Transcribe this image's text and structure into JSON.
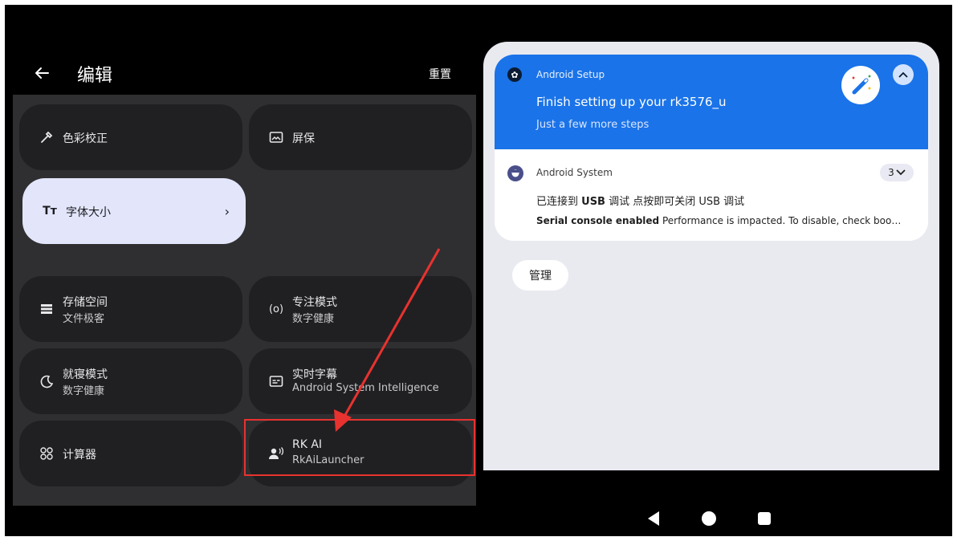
{
  "header": {
    "title": "编辑",
    "reset_label": "重置"
  },
  "tiles": [
    {
      "id": "color-correction",
      "icon": "dropper-icon",
      "label": "色彩校正",
      "sublabel": ""
    },
    {
      "id": "screensaver",
      "icon": "screensaver-icon",
      "label": "屏保",
      "sublabel": ""
    },
    {
      "id": "font-size",
      "icon": "font-size-icon",
      "label": "字体大小",
      "sublabel": "",
      "active": true
    },
    {
      "id": "storage",
      "icon": "storage-icon",
      "label": "存储空间",
      "sublabel": "文件极客"
    },
    {
      "id": "focus-mode",
      "icon": "focus-icon",
      "label": "专注模式",
      "sublabel": "数字健康"
    },
    {
      "id": "bedtime-mode",
      "icon": "bedtime-icon",
      "label": "就寝模式",
      "sublabel": "数字健康"
    },
    {
      "id": "live-caption",
      "icon": "caption-icon",
      "label": "实时字幕",
      "sublabel": "Android System Intelligence"
    },
    {
      "id": "calculator",
      "icon": "calculator-icon",
      "label": "计算器",
      "sublabel": ""
    },
    {
      "id": "rk-ai",
      "icon": "voice-person-icon",
      "label": "RK AI",
      "sublabel": "RkAiLauncher"
    }
  ],
  "notifications": {
    "setup": {
      "app_name": "Android Setup",
      "title": "Finish setting up your rk3576_u",
      "subtitle": "Just a few more steps"
    },
    "system": {
      "app_name": "Android System",
      "count": "3",
      "line1_prefix": "已连接到 ",
      "line1_bold": "USB",
      "line1_suffix": " 调试 点按即可关闭 USB 调试",
      "line2_bold": "Serial console enabled",
      "line2_text": " Performance is impacted. To disable, check boo…"
    },
    "manage_label": "管理"
  },
  "colors": {
    "screen_bg": "#000000",
    "panel_bg": "#2f2f31",
    "tile_bg": "#202022",
    "tile_active_bg": "#e3e6fb",
    "setup_blue": "#1a73e8",
    "shade_bg": "#e9eaf0",
    "annotation_red": "#e8322f"
  }
}
